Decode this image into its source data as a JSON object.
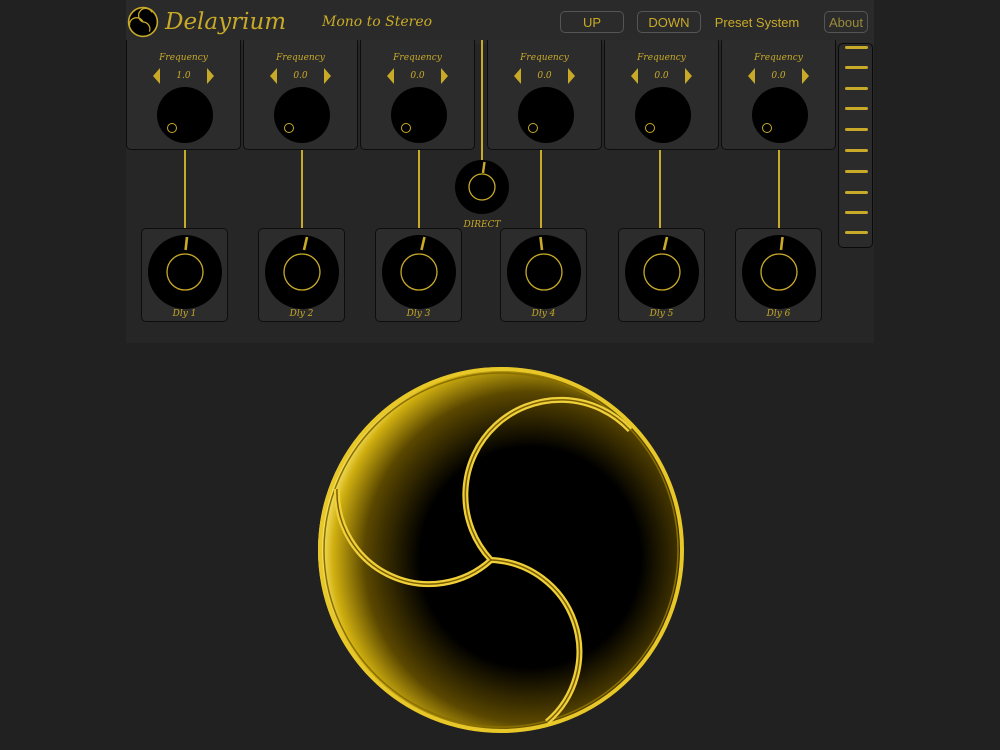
{
  "app": {
    "title": "Delayrium",
    "mode": "Mono to Stereo",
    "up_label": "UP",
    "down_label": "DOWN",
    "preset_label": "Preset System",
    "about_label": "About"
  },
  "modules": [
    {
      "label": "Frequency",
      "value": "1.0"
    },
    {
      "label": "Frequency",
      "value": "0.0"
    },
    {
      "label": "Frequency",
      "value": "0.0"
    },
    {
      "label": "Frequency",
      "value": "0.0"
    },
    {
      "label": "Frequency",
      "value": "0.0"
    },
    {
      "label": "Frequency",
      "value": "0.0"
    }
  ],
  "delays": [
    {
      "label": "Dly 1"
    },
    {
      "label": "Dly 2"
    },
    {
      "label": "Dly 3"
    },
    {
      "label": "Dly 4"
    },
    {
      "label": "Dly 5"
    },
    {
      "label": "Dly 6"
    }
  ],
  "direct": {
    "label": "DIRECT"
  },
  "colors": {
    "accent": "#c8aa28",
    "background": "#212121",
    "panel": "#2c2c2c",
    "knob": "#000000"
  },
  "icons": [
    "delayrium-logo-icon",
    "arrow-left-icon",
    "arrow-right-icon"
  ]
}
